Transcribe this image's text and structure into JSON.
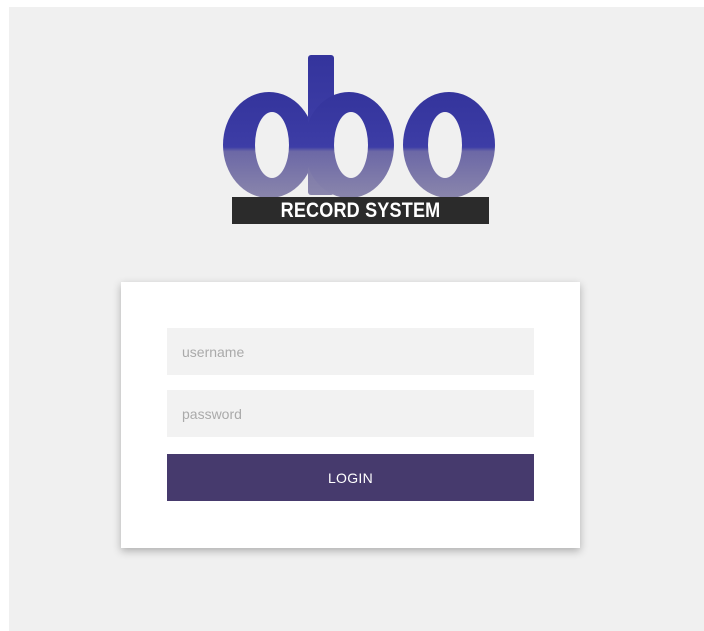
{
  "logo": {
    "wordmark": "obo",
    "tagline": "RECORD SYSTEM",
    "colors": {
      "brand_top": "#3a3aa0",
      "brand_bottom": "#7c79a8",
      "banner": "#2b2b2b"
    }
  },
  "login_form": {
    "username_placeholder": "username",
    "password_placeholder": "password",
    "login_label": "LOGIN",
    "button_color": "#463a6d"
  }
}
